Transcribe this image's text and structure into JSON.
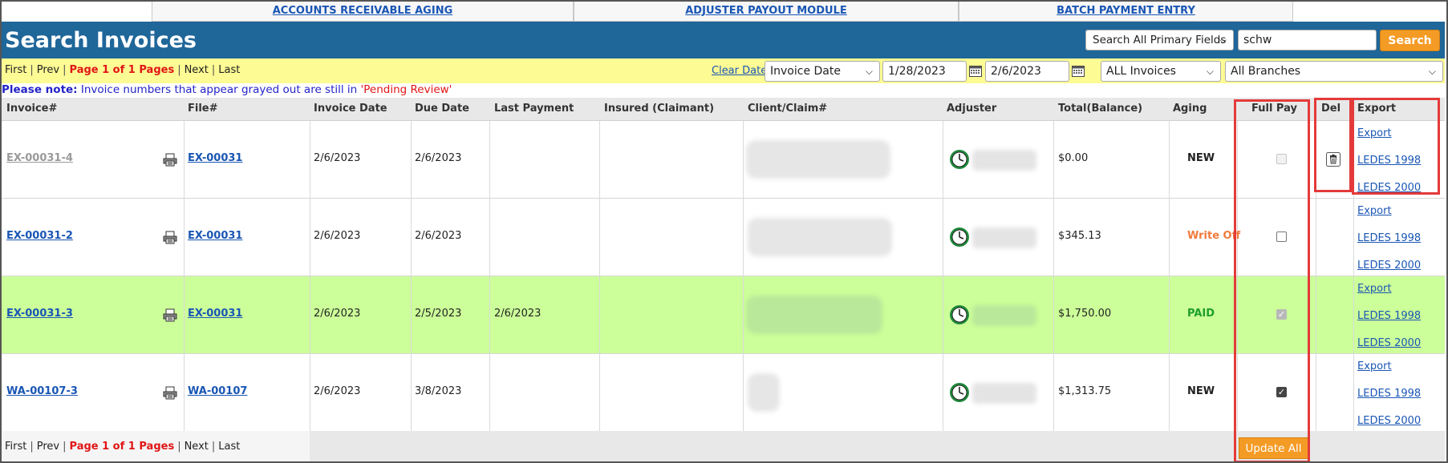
{
  "top_tabs": [
    {
      "label": "ACCOUNTS RECEIVABLE AGING"
    },
    {
      "label": "ADJUSTER PAYOUT MODULE"
    },
    {
      "label": "BATCH PAYMENT ENTRY"
    }
  ],
  "title": "Search Invoices",
  "search": {
    "field_select": "Search All Primary Fields",
    "query": "schw",
    "button": "Search"
  },
  "pager": {
    "first": "First",
    "prev": "Prev",
    "current": "Page 1 of 1 Pages",
    "next": "Next",
    "last": "Last",
    "separator": "|"
  },
  "filters": {
    "clear_dates": "Clear Dates",
    "date_type": "Invoice Date",
    "date_from": "1/28/2023",
    "date_to": "2/6/2023",
    "invoice_filter": "ALL Invoices",
    "branch_filter": "All Branches"
  },
  "note": {
    "label": "Please note:",
    "text": " Invoice numbers that appear grayed out are still in ",
    "status": "'Pending Review'"
  },
  "columns": {
    "invoice": "Invoice#",
    "file": "File#",
    "invoice_date": "Invoice Date",
    "due_date": "Due Date",
    "last_payment": "Last Payment",
    "insured": "Insured (Claimant)",
    "client_claim": "Client/Claim#",
    "adjuster": "Adjuster",
    "total": "Total(Balance)",
    "aging": "Aging",
    "full_pay": "Full Pay",
    "del": "Del",
    "export": "Export"
  },
  "rows": [
    {
      "invoice": "EX-00031-4",
      "file": "EX-00031",
      "invoice_date": "2/6/2023",
      "due_date": "2/6/2023",
      "last_payment": "",
      "total": "$0.00",
      "aging": "NEW",
      "aging_color": "#222222",
      "full_pay_checked": false,
      "full_pay_disabled": true,
      "pending": true,
      "paid": false,
      "has_delete": true
    },
    {
      "invoice": "EX-00031-2",
      "file": "EX-00031",
      "invoice_date": "2/6/2023",
      "due_date": "2/6/2023",
      "last_payment": "",
      "total": "$345.13",
      "aging": "Write Off",
      "aging_color": "#f07a3c",
      "full_pay_checked": false,
      "full_pay_disabled": false,
      "pending": false,
      "paid": false,
      "has_delete": false
    },
    {
      "invoice": "EX-00031-3",
      "file": "EX-00031",
      "invoice_date": "2/6/2023",
      "due_date": "2/5/2023",
      "last_payment": "2/6/2023",
      "total": "$1,750.00",
      "aging": "PAID",
      "aging_color": "#1c9e2c",
      "full_pay_checked": true,
      "full_pay_disabled": true,
      "pending": false,
      "paid": true,
      "has_delete": false
    },
    {
      "invoice": "WA-00107-3",
      "file": "WA-00107",
      "invoice_date": "2/6/2023",
      "due_date": "3/8/2023",
      "last_payment": "",
      "total": "$1,313.75",
      "aging": "NEW",
      "aging_color": "#222222",
      "full_pay_checked": true,
      "full_pay_disabled": false,
      "pending": false,
      "paid": false,
      "has_delete": false
    }
  ],
  "export_links": {
    "export": "Export",
    "ledes1998": "LEDES 1998",
    "ledes2000": "LEDES 2000"
  },
  "footer": {
    "update_all": "Update All"
  },
  "icons": {
    "printer": "printer-icon",
    "clock": "clock-icon",
    "calendar": "calendar-icon",
    "trash": "trash-icon",
    "chevron": "chevron-down-icon"
  },
  "colors": {
    "title_bar": "#1f6699",
    "accent_orange": "#f49b25",
    "pager_bar": "#fdfb93",
    "paid_row": "#ccff99",
    "highlight_box": "#e43a3a"
  }
}
